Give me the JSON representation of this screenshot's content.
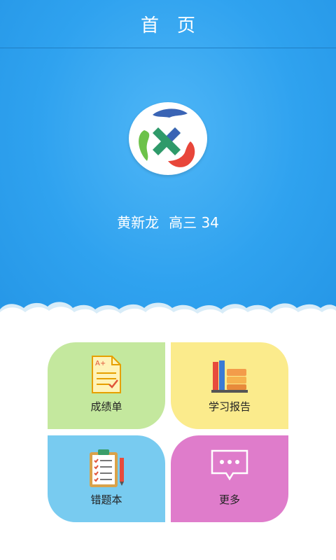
{
  "header": {
    "title": "首页"
  },
  "user": {
    "name": "黄新龙",
    "class": "高三 34"
  },
  "tiles": [
    {
      "label": "成绩单",
      "icon": "report-card-icon",
      "color": "#c4e89e"
    },
    {
      "label": "学习报告",
      "icon": "books-icon",
      "color": "#fbeb8c"
    },
    {
      "label": "错题本",
      "icon": "clipboard-icon",
      "color": "#78cbf0"
    },
    {
      "label": "更多",
      "icon": "chat-bubble-icon",
      "color": "#df7ccb"
    }
  ],
  "colors": {
    "primary": "#2fa2ef"
  }
}
